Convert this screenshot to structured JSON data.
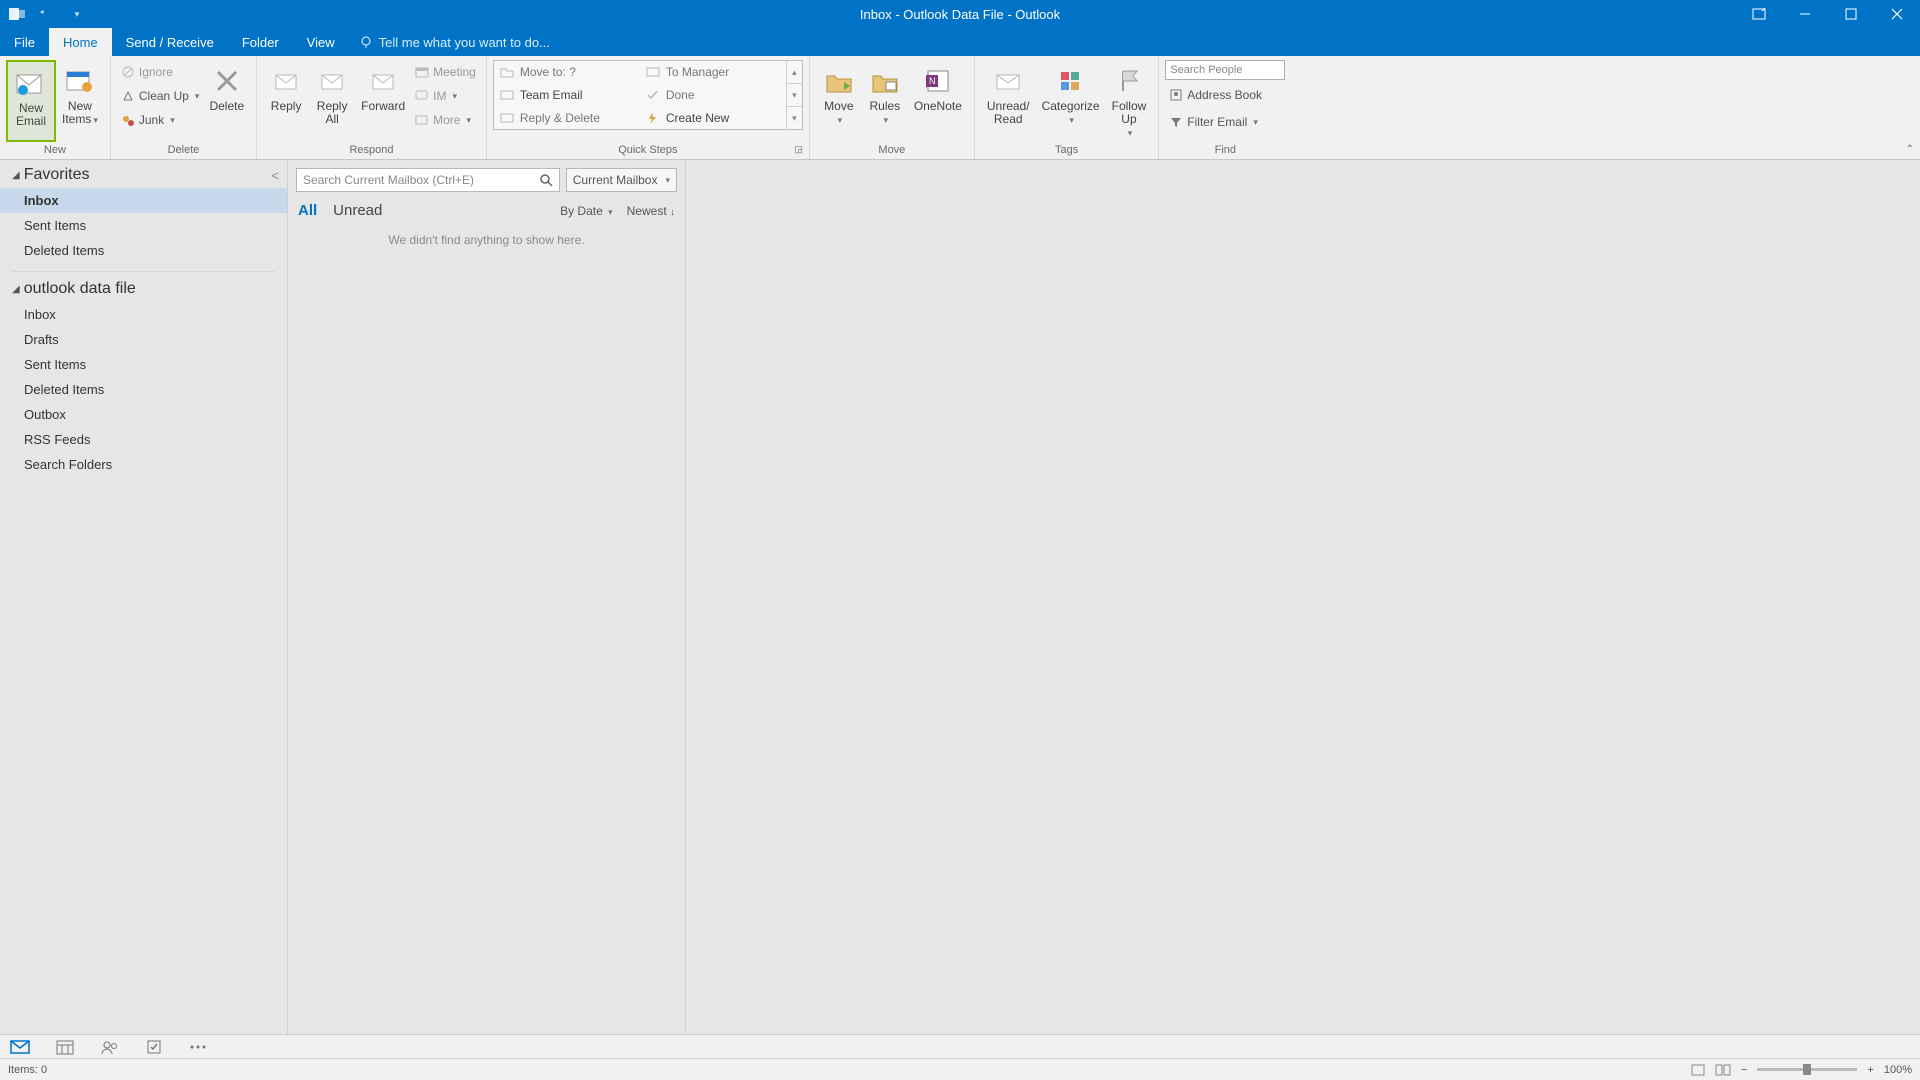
{
  "titlebar": {
    "title": "Inbox - Outlook Data File - Outlook"
  },
  "tabs": {
    "file": "File",
    "home": "Home",
    "sendreceive": "Send / Receive",
    "folder": "Folder",
    "view": "View",
    "tellme": "Tell me what you want to do..."
  },
  "ribbon": {
    "new": {
      "newemail": "New\nEmail",
      "newitems": "New\nItems",
      "group": "New"
    },
    "delete": {
      "ignore": "Ignore",
      "cleanup": "Clean Up",
      "junk": "Junk",
      "delete": "Delete",
      "group": "Delete"
    },
    "respond": {
      "reply": "Reply",
      "replyall": "Reply\nAll",
      "forward": "Forward",
      "meeting": "Meeting",
      "im": "IM",
      "more": "More",
      "group": "Respond"
    },
    "quicksteps": {
      "moveto": "Move to: ?",
      "teamemail": "Team Email",
      "replydelete": "Reply & Delete",
      "tomanager": "To Manager",
      "done": "Done",
      "createnew": "Create New",
      "group": "Quick Steps"
    },
    "move": {
      "move": "Move",
      "rules": "Rules",
      "onenote": "OneNote",
      "group": "Move"
    },
    "tags": {
      "unread": "Unread/\nRead",
      "categorize": "Categorize",
      "followup": "Follow\nUp",
      "group": "Tags"
    },
    "find": {
      "searchpeople": "Search People",
      "addressbook": "Address Book",
      "filteremail": "Filter Email",
      "group": "Find"
    }
  },
  "nav": {
    "favorites": "Favorites",
    "fav_items": {
      "inbox": "Inbox",
      "sent": "Sent Items",
      "deleted": "Deleted Items"
    },
    "datafile": "outlook data file",
    "df_items": {
      "inbox": "Inbox",
      "drafts": "Drafts",
      "sent": "Sent Items",
      "deleted": "Deleted Items",
      "outbox": "Outbox",
      "rss": "RSS Feeds",
      "search": "Search Folders"
    }
  },
  "msglist": {
    "search_placeholder": "Search Current Mailbox (Ctrl+E)",
    "scope": "Current Mailbox",
    "all": "All",
    "unread": "Unread",
    "bydate": "By Date",
    "newest": "Newest",
    "empty": "We didn't find anything to show here."
  },
  "status": {
    "items": "Items: 0",
    "zoom": "100%"
  }
}
